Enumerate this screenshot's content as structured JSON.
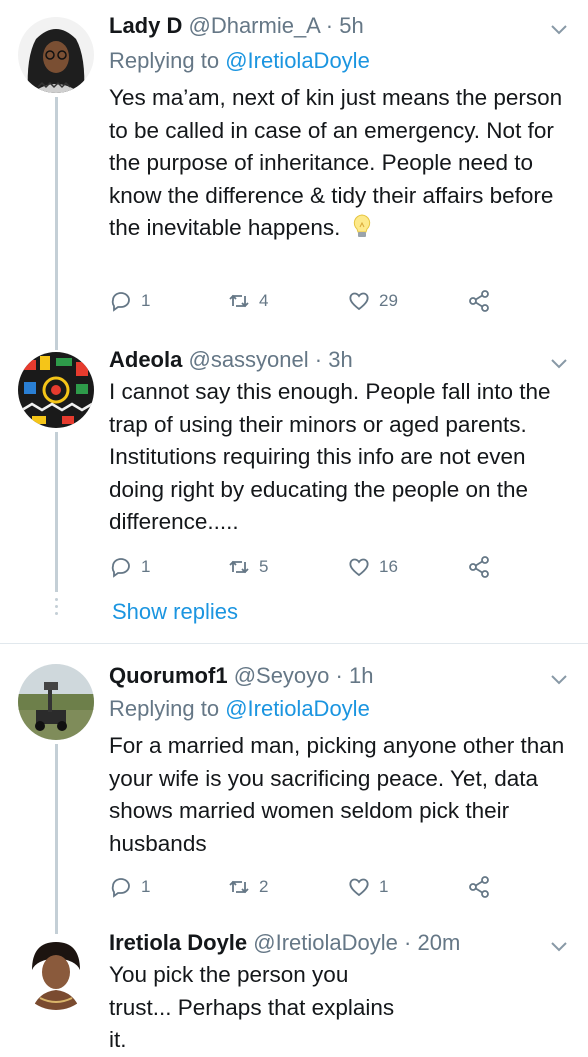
{
  "tweets": [
    {
      "name": "Lady D",
      "handle": "@Dharmie_A",
      "dot": "·",
      "time": "5h",
      "replying_prefix": "Replying to ",
      "replying_to": "@IretiolaDoyle",
      "text": "Yes ma’am, next of kin just means the person to be called in case of an emergency. Not for the purpose of inheritance. People need to know the difference & tidy their affairs before the inevitable happens.",
      "emoji": "lightbulb-icon",
      "replies": "1",
      "retweets": "4",
      "likes": "29"
    },
    {
      "name": "Adeola",
      "handle": "@sassyonel",
      "dot": "·",
      "time": "3h",
      "text": "I cannot say this enough. People fall into the trap of using their minors or aged parents. Institutions requiring this info are not even doing right by educating the people on the difference.....",
      "replies": "1",
      "retweets": "5",
      "likes": "16"
    },
    {
      "name": "Quorumof1",
      "handle": "@Seyoyo",
      "dot": "·",
      "time": "1h",
      "replying_prefix": "Replying to ",
      "replying_to": "@IretiolaDoyle",
      "text": "For a married man, picking anyone other than your wife is you sacrificing peace. Yet, data shows married women seldom pick their husbands",
      "replies": "1",
      "retweets": "2",
      "likes": "1"
    },
    {
      "name": "Iretiola Doyle",
      "handle": "@IretiolaDoyle",
      "dot": "·",
      "time": "20m",
      "text": "You pick the person you trust... Perhaps that explains it."
    }
  ],
  "show_replies_label": "Show replies",
  "colors": {
    "link": "#1b95e0",
    "secondary": "#657786",
    "primary": "#14171a",
    "divider": "#e1e8ed"
  }
}
